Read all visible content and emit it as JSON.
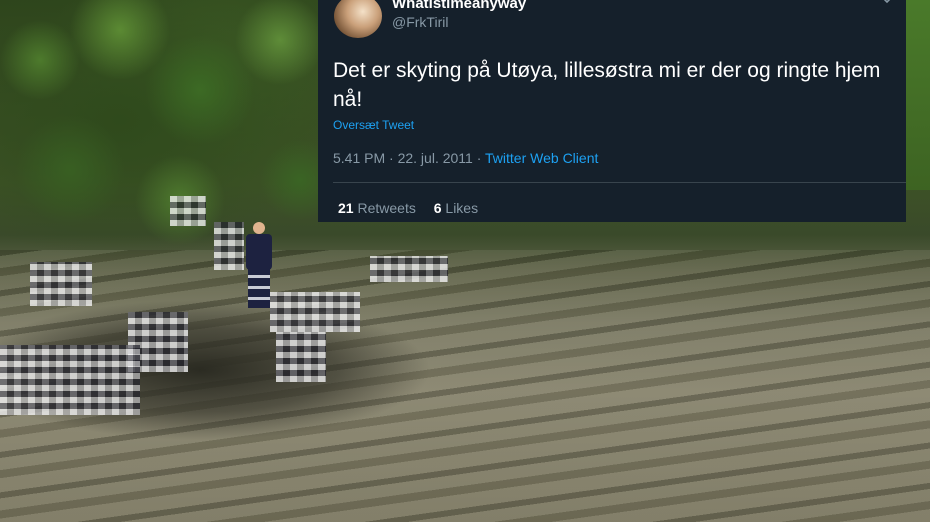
{
  "tweet": {
    "display_name": "Whatistimeanyway",
    "handle": "@FrkTiril",
    "text": "Det er skyting på Utøya, lillesøstra mi er der og ringte hjem nå!",
    "translate_link": "Oversæt Tweet",
    "timestamp": "5.41 PM · 22. jul. 2011",
    "separator": "·",
    "source": "Twitter Web Client",
    "retweets_count": "21",
    "retweets_label": "Retweets",
    "likes_count": "6",
    "likes_label": "Likes",
    "icons": {
      "avatar": "avatar",
      "menu": "chevron-down-icon"
    },
    "colors": {
      "background": "#15202b",
      "link": "#1da1f2",
      "muted": "#8899a6"
    }
  }
}
